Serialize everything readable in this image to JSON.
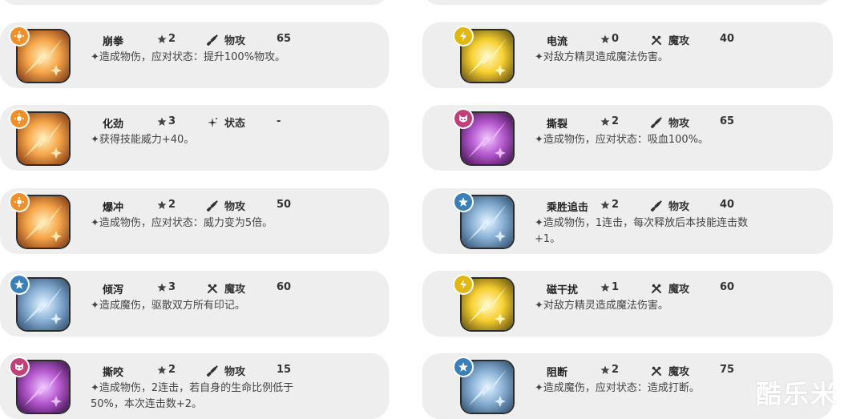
{
  "skills_left": [
    {
      "name": "崩拳",
      "cost": "2",
      "type_label": "物攻",
      "type_icon": "sword-icon",
      "power": "65",
      "desc": "✦造成物伤，应对状态：提升100%物攻。",
      "element": "fire",
      "element_color": "#f0902a"
    },
    {
      "name": "化劲",
      "cost": "3",
      "type_label": "状态",
      "type_icon": "sparkle-icon",
      "power": "-",
      "desc": "✦获得技能威力+40。",
      "element": "fire",
      "element_color": "#f0902a"
    },
    {
      "name": "爆冲",
      "cost": "2",
      "type_label": "物攻",
      "type_icon": "sword-icon",
      "power": "50",
      "desc": "✦造成物伤，应对状态：威力变为5倍。",
      "element": "fire",
      "element_color": "#f0902a"
    },
    {
      "name": "倾泻",
      "cost": "3",
      "type_label": "魔攻",
      "type_icon": "wand-icon",
      "power": "60",
      "desc": "✦造成魔伤，驱散双方所有印记。",
      "element": "ice",
      "element_color": "#3a7fb8"
    },
    {
      "name": "撕咬",
      "cost": "2",
      "type_label": "物攻",
      "type_icon": "sword-icon",
      "power": "15",
      "desc": "✦造成物伤，2连击，若自身的生命比例低于\n50%，本次连击数+2。",
      "element": "dark",
      "element_color": "#c0407a"
    }
  ],
  "skills_right": [
    {
      "name": "电流",
      "cost": "0",
      "type_label": "魔攻",
      "type_icon": "wand-icon",
      "power": "40",
      "desc": "✦对敌方精灵造成魔法伤害。",
      "element": "electric",
      "element_color": "#e0b810"
    },
    {
      "name": "撕裂",
      "cost": "2",
      "type_label": "物攻",
      "type_icon": "sword-icon",
      "power": "65",
      "desc": "✦造成物伤，应对状态：吸血100%。",
      "element": "dark",
      "element_color": "#c0407a"
    },
    {
      "name": "乘胜追击",
      "cost": "2",
      "type_label": "物攻",
      "type_icon": "sword-icon",
      "power": "40",
      "desc": "✦造成物伤，1连击，每次释放后本技能连击数\n+1。",
      "element": "ice",
      "element_color": "#3a7fb8"
    },
    {
      "name": "磁干扰",
      "cost": "1",
      "type_label": "魔攻",
      "type_icon": "wand-icon",
      "power": "60",
      "desc": "✦对敌方精灵造成魔法伤害。",
      "element": "electric",
      "element_color": "#e0b810"
    },
    {
      "name": "阻断",
      "cost": "2",
      "type_label": "魔攻",
      "type_icon": "wand-icon",
      "power": "75",
      "desc": "✦造成魔伤，应对状态：造成打断。",
      "element": "ice",
      "element_color": "#3a7fb8"
    }
  ],
  "watermark": "酷乐米"
}
